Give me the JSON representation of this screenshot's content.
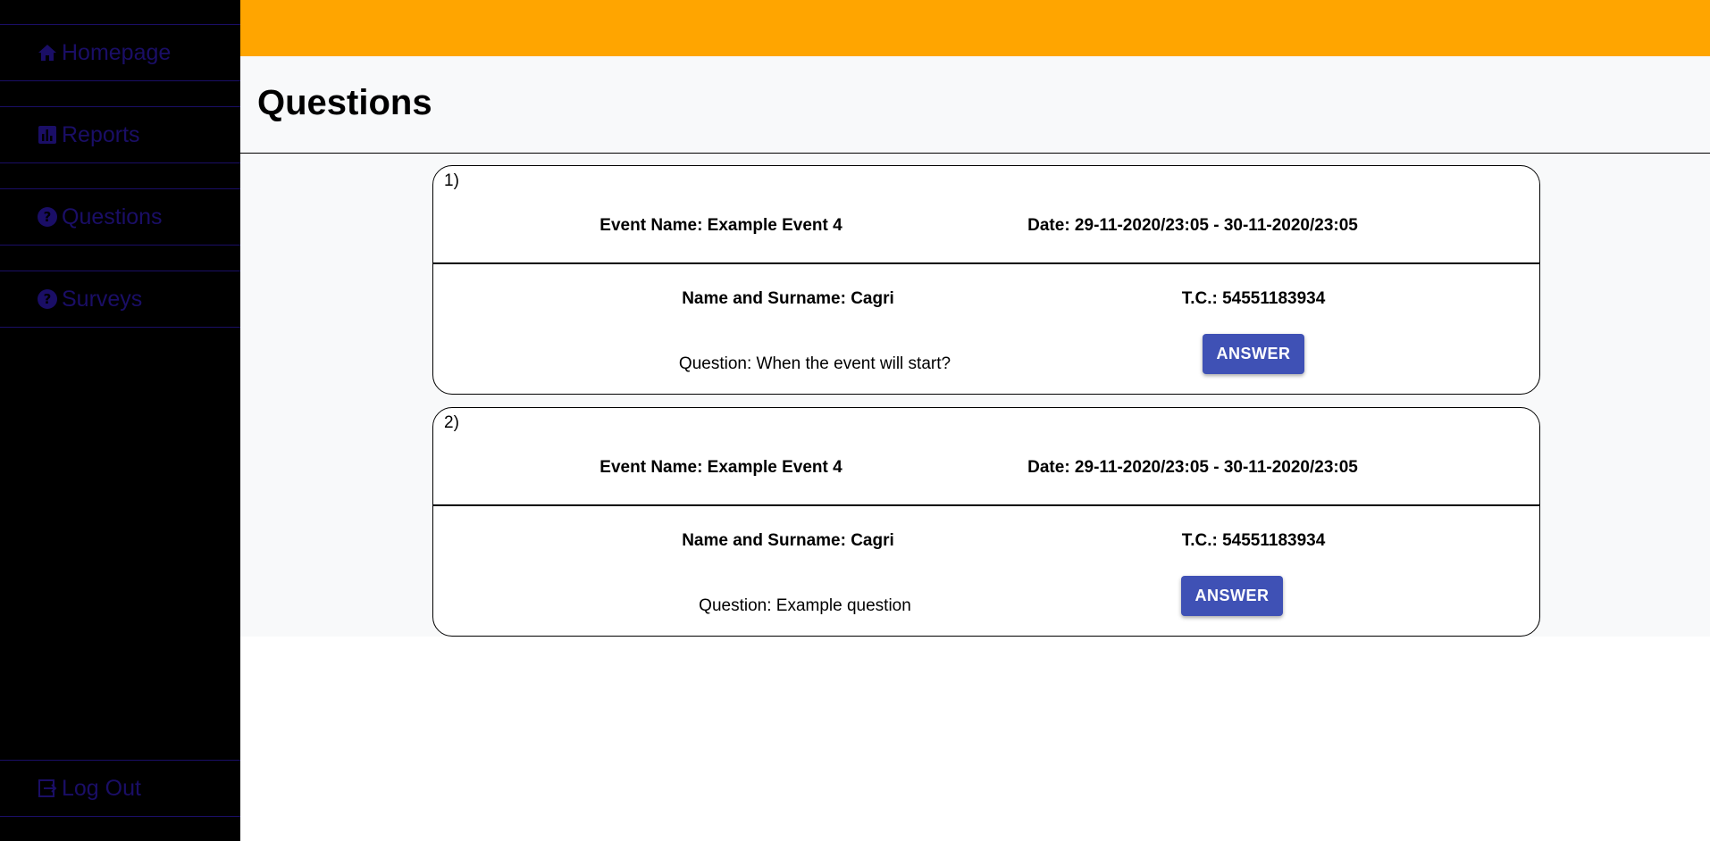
{
  "sidebar": {
    "items": [
      {
        "label": "Homepage",
        "icon": "home-icon"
      },
      {
        "label": "Reports",
        "icon": "chart-icon"
      },
      {
        "label": "Questions",
        "icon": "question-circle-icon"
      },
      {
        "label": "Surveys",
        "icon": "question-circle-icon"
      }
    ],
    "logout": {
      "label": "Log Out",
      "icon": "sign-out-icon"
    }
  },
  "colors": {
    "topbar": "#ffa500",
    "sidebar": "#000000",
    "nav_text": "#1a0e66",
    "button": "#3f51b5"
  },
  "page": {
    "title": "Questions"
  },
  "questions": [
    {
      "number": "1)",
      "event": "Event Name: Example Event 4",
      "date": "Date: 29-11-2020/23:05 - 30-11-2020/23:05",
      "name": "Name and Surname: Cagri",
      "tc": "T.C.: 54551183934",
      "question": "Question: When the event will start?",
      "button": "ANSWER"
    },
    {
      "number": "2)",
      "event": "Event Name: Example Event 4",
      "date": "Date: 29-11-2020/23:05 - 30-11-2020/23:05",
      "name": "Name and Surname: Cagri",
      "tc": "T.C.: 54551183934",
      "question": "Question: Example question",
      "button": "ANSWER"
    }
  ]
}
